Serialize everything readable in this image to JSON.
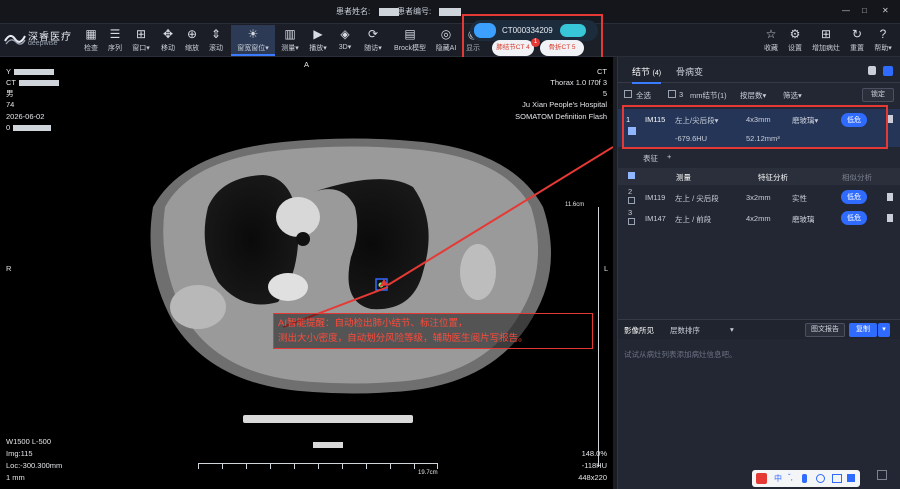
{
  "titlebar": {
    "patient_name_label": "患者姓名:",
    "patient_id_label": "患者编号:",
    "minimize": "—",
    "maximize": "□",
    "close": "✕"
  },
  "app": {
    "logo_cn": "深睿医疗",
    "logo_en": "deepwise"
  },
  "toolbar": {
    "tools": [
      {
        "label": "检查",
        "icon": "grid-icon"
      },
      {
        "label": "序列",
        "icon": "list-icon"
      },
      {
        "label": "窗口▾",
        "icon": "window-icon"
      },
      {
        "label": "移动",
        "icon": "move-icon"
      },
      {
        "label": "缩放",
        "icon": "zoom-icon"
      },
      {
        "label": "滚动",
        "icon": "scroll-icon"
      },
      {
        "label": "窗宽窗位▾",
        "icon": "window-level-icon"
      },
      {
        "label": "测量▾",
        "icon": "measure-icon"
      },
      {
        "label": "播放▾",
        "icon": "play-icon"
      },
      {
        "label": "3D▾",
        "icon": "3d-icon"
      },
      {
        "label": "随访▾",
        "icon": "followup-icon"
      },
      {
        "label": "Brock模型",
        "icon": "model-icon"
      },
      {
        "label": "隐藏AI",
        "icon": "ai-icon"
      },
      {
        "label": "显示",
        "icon": "eye-icon"
      }
    ],
    "right_tools": [
      {
        "label": "收藏",
        "icon": "star-icon"
      },
      {
        "label": "设置",
        "icon": "gear-icon"
      },
      {
        "label": "增加病灶",
        "icon": "add-icon"
      },
      {
        "label": "重置",
        "icon": "reset-icon"
      },
      {
        "label": "帮助▾",
        "icon": "help-icon"
      }
    ]
  },
  "ai_popup": {
    "case_id": "CT000334209",
    "tab1": "肺结节CT 4",
    "tab2": "骨折CT 5",
    "badge": "1"
  },
  "overlay": {
    "left_top": [
      "Y",
      "CT",
      "男",
      "74",
      "2026-06-02",
      "0"
    ],
    "right_top": [
      "CT",
      "Thorax 1.0 I70f 3",
      "5",
      "Ju Xian People's Hospital",
      "SOMATOM Definition Flash"
    ],
    "orient_top": "A",
    "orient_left": "R",
    "orient_right": "L",
    "scale_side": "11.6cm",
    "scale_bottom": "19.7cm",
    "left_bottom": [
      "W1500 L-500",
      "Img:115",
      "Loc:-300.300mm",
      "1 mm"
    ],
    "right_bottom": [
      "148.0%",
      "-118HU",
      "448x220"
    ]
  },
  "callout": {
    "line1": "AI智能提醒：自动检出肺小结节、标注位置，",
    "line2": "测出大小/密度，自动划分风险等级，辅助医生阅片写报告。"
  },
  "right_panel": {
    "tabs": [
      "结节",
      "骨病变"
    ],
    "tab_count": "(4)",
    "select_all": "全选",
    "size_value": "3",
    "size_label": "mm结节(1)",
    "sort_label": "按层数▾",
    "filter_label": "筛选▾",
    "lock_label": "锁定",
    "nodules": [
      {
        "idx": "1",
        "id": "IM115",
        "loc": "左上/尖后段▾",
        "size": "4x3mm",
        "type": "磨玻璃▾",
        "risk": "低危",
        "hu": "-679.6HU",
        "vol": "52.12mm³"
      },
      {
        "idx": "2",
        "id": "IM119",
        "loc": "左上 / 尖后段",
        "size": "3x2mm",
        "type": "实性",
        "risk": "低危"
      },
      {
        "idx": "3",
        "id": "IM147",
        "loc": "左上 / 前段",
        "size": "4x2mm",
        "type": "磨玻璃",
        "risk": "低危"
      }
    ],
    "feature_label": "表征",
    "feature_add": "+",
    "measure_tab": "测量",
    "feature_tab": "特征分析",
    "similar_tab": "相似分析",
    "findings_label": "影像所见",
    "layer_sort": "层数排序",
    "report_btn": "图文报告",
    "copy_btn": "复制",
    "placeholder": "试试从病灶列表添加病灶信息吧。"
  },
  "colors": {
    "accent": "#3b7cff",
    "alert": "#e53935",
    "risk_low": "#2f6bff"
  }
}
